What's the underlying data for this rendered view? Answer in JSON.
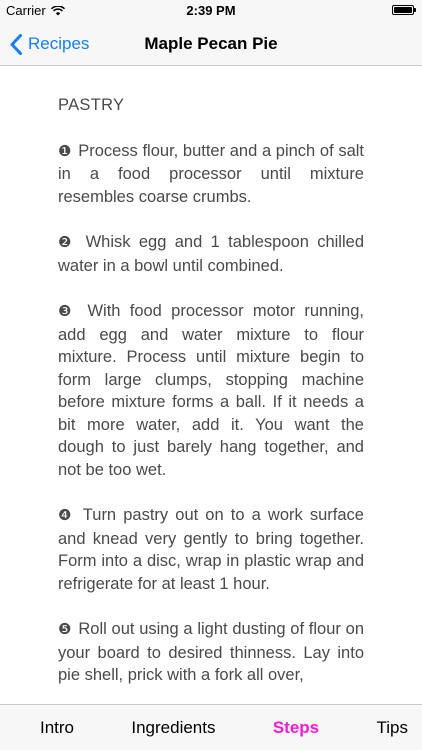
{
  "status_bar": {
    "carrier": "Carrier",
    "time": "2:39 PM"
  },
  "nav": {
    "back_label": "Recipes",
    "title": "Maple Pecan Pie"
  },
  "content": {
    "section_title": "PASTRY",
    "steps": [
      {
        "num": "❶",
        "text": "Process flour, butter and a pinch of salt in a food processor until mixture resembles coarse crumbs."
      },
      {
        "num": "❷",
        "text": "Whisk egg and 1 tablespoon chilled water in a bowl until combined."
      },
      {
        "num": "❸",
        "text": "With food processor motor running, add egg and water mixture to flour mixture. Process until mixture begin to form large clumps, stopping machine before mixture forms a ball. If it needs a bit more water, add it. You want the dough to just barely hang together, and not be too wet."
      },
      {
        "num": "❹",
        "text": "Turn pastry out on to a work surface and knead very gently to bring together. Form into a disc, wrap in plastic wrap and  refrigerate for at least 1 hour."
      },
      {
        "num": "❺",
        "text": "Roll out using a light dusting of flour on your board to desired thinness. Lay into pie shell, prick with a fork all over,"
      }
    ]
  },
  "tabs": [
    {
      "label": "Intro",
      "active": false
    },
    {
      "label": "Ingredients",
      "active": false
    },
    {
      "label": "Steps",
      "active": true
    },
    {
      "label": "Tips",
      "active": false
    }
  ],
  "colors": {
    "accent_blue": "#157efb",
    "active_tab": "#fc18d8"
  }
}
